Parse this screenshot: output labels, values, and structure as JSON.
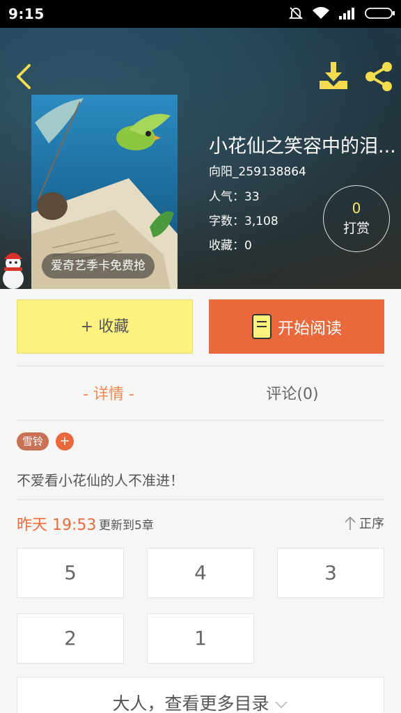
{
  "status_bar": {
    "time": "9:15"
  },
  "book": {
    "title": "小花仙之笑容中的泪...",
    "author": "向阳_259138864",
    "popularity": "人气：33",
    "word_count": "字数：3,108",
    "collections": "收藏：0",
    "promo": "爱奇艺季卡免费抢"
  },
  "reward": {
    "count": "0",
    "label": "打赏"
  },
  "actions": {
    "collect": "+ 收藏",
    "read": "开始阅读"
  },
  "tabs": {
    "details": "- 详情 -",
    "comments": "评论(0)"
  },
  "tags": {
    "tag": "雪铃",
    "add": "+"
  },
  "intro": "不爱看小花仙的人不准进！",
  "update": {
    "time": "昨天 19:53",
    "count": "更新到5章",
    "sort": "正序"
  },
  "chapters": [
    "5",
    "4",
    "3",
    "2",
    "1"
  ],
  "more": "大人，查看更多目录",
  "colors": {
    "accent": "#e9693d",
    "collect": "#fcf27d",
    "icon_yellow": "#f3dd4e"
  }
}
